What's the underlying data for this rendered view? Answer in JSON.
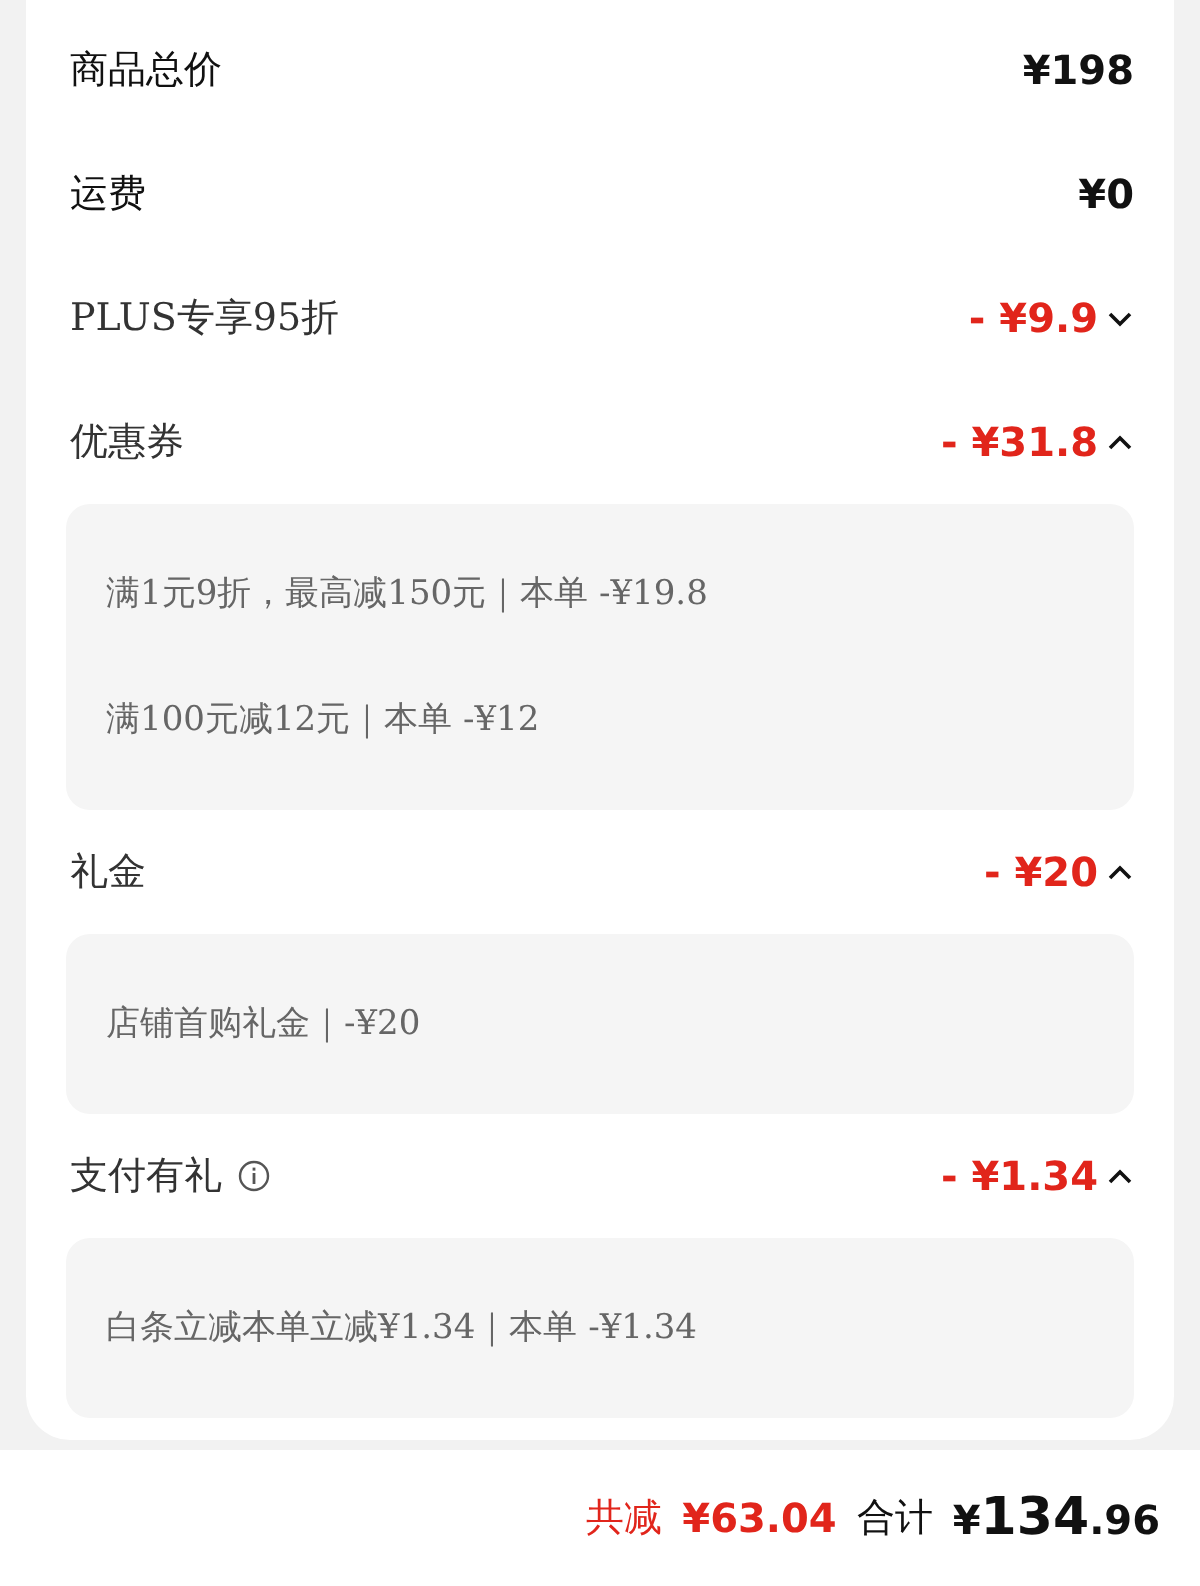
{
  "items": [
    {
      "kind": "plain",
      "label": "商品总价",
      "amount": "¥198",
      "info_icon": false
    },
    {
      "kind": "plain",
      "label": "运费",
      "amount": "¥0",
      "info_icon": false
    },
    {
      "kind": "discount",
      "label": "PLUS专享95折",
      "amount": "- ¥9.9",
      "expanded": false,
      "info_icon": false
    },
    {
      "kind": "discount",
      "label": "优惠券",
      "amount": "- ¥31.8",
      "expanded": true,
      "info_icon": false,
      "details": [
        "满1元9折，最高减150元｜本单 -¥19.8",
        "满100元减12元｜本单 -¥12"
      ]
    },
    {
      "kind": "discount",
      "label": "礼金",
      "amount": "- ¥20",
      "expanded": true,
      "info_icon": false,
      "details": [
        "店铺首购礼金｜-¥20"
      ]
    },
    {
      "kind": "discount",
      "label": "支付有礼",
      "amount": "- ¥1.34",
      "expanded": true,
      "info_icon": true,
      "details": [
        "白条立减本单立减¥1.34｜本单 -¥1.34"
      ]
    }
  ],
  "footer": {
    "saved_label": "共减",
    "saved_amount": "¥63.04",
    "total_label": "合计",
    "total_amount": "¥134.96"
  }
}
